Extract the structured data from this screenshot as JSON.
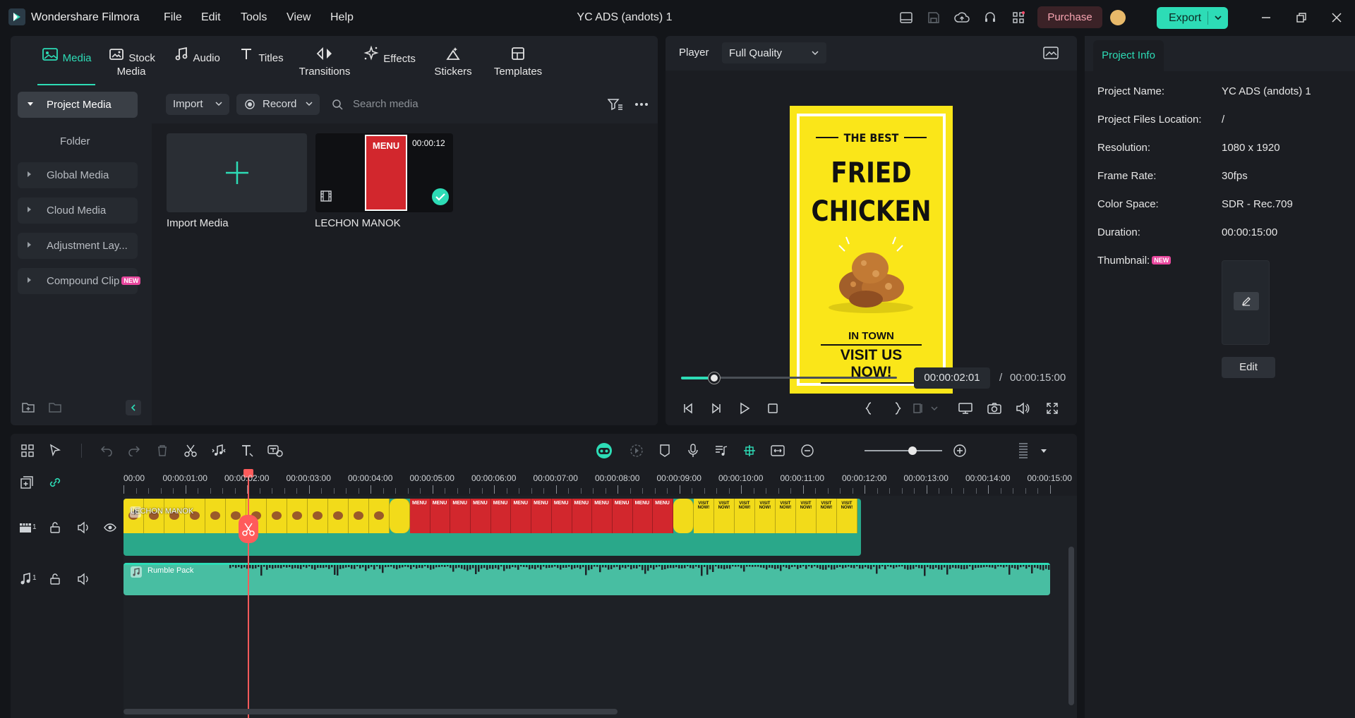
{
  "app": {
    "name": "Wondershare Filmora",
    "document_title": "YC ADS (andots) 1"
  },
  "menu": [
    "File",
    "Edit",
    "Tools",
    "View",
    "Help"
  ],
  "titlebar": {
    "purchase_label": "Purchase",
    "export_label": "Export"
  },
  "tabs": [
    {
      "label": "Media",
      "icon": "media-icon",
      "active": true
    },
    {
      "label": "Stock Media",
      "icon": "stock-media-icon"
    },
    {
      "label": "Audio",
      "icon": "music-note-icon"
    },
    {
      "label": "Titles",
      "icon": "text-t-icon"
    },
    {
      "label": "Transitions",
      "icon": "transitions-icon"
    },
    {
      "label": "Effects",
      "icon": "effects-sparkle-icon"
    },
    {
      "label": "Stickers",
      "icon": "stickers-icon"
    },
    {
      "label": "Templates",
      "icon": "templates-icon"
    }
  ],
  "sidebar": {
    "items": [
      {
        "label": "Project Media",
        "active": true
      },
      {
        "label": "Folder"
      },
      {
        "label": "Global Media"
      },
      {
        "label": "Cloud Media"
      },
      {
        "label": "Adjustment Lay..."
      },
      {
        "label": "Compound Clip",
        "badge": "NEW"
      }
    ]
  },
  "media_toolbar": {
    "import_label": "Import",
    "record_label": "Record",
    "search_placeholder": "Search media"
  },
  "media_items": [
    {
      "title": "Import Media"
    },
    {
      "title": "LECHON MANOK",
      "duration": "00:00:12",
      "thumb_text": "MENU"
    }
  ],
  "player": {
    "label": "Player",
    "quality": "Full Quality",
    "current_time": "00:00:02:01",
    "separator": "/",
    "total_time": "00:00:15:00",
    "progress": 0.135,
    "poster": {
      "line1": "THE BEST",
      "line2": "FRIED",
      "line3": "CHICKEN",
      "line4": "IN TOWN",
      "line5": "VISIT US NOW!",
      "bg_color": "#fae619"
    }
  },
  "project_info": {
    "tab_label": "Project Info",
    "rows": [
      {
        "label": "Project Name:",
        "value": "YC ADS (andots) 1"
      },
      {
        "label": "Project Files Location:",
        "value": "/"
      },
      {
        "label": "Resolution:",
        "value": "1080 x 1920"
      },
      {
        "label": "Frame Rate:",
        "value": "30fps"
      },
      {
        "label": "Color Space:",
        "value": "SDR - Rec.709"
      },
      {
        "label": "Duration:",
        "value": "00:00:15:00"
      }
    ],
    "thumbnail_label": "Thumbnail:",
    "thumbnail_badge": "NEW",
    "edit_label": "Edit"
  },
  "timeline": {
    "ruler": [
      "00:00",
      "00:00:01:00",
      "00:00:02:00",
      "00:00:03:00",
      "00:00:04:00",
      "00:00:05:00",
      "00:00:06:00",
      "00:00:07:00",
      "00:00:08:00",
      "00:00:09:00",
      "00:00:10:00",
      "00:00:11:00",
      "00:00:12:00",
      "00:00:13:00",
      "00:00:14:00",
      "00:00:15:00"
    ],
    "video_track": {
      "index": "1",
      "clip_label": "LECHON MANOK"
    },
    "audio_track": {
      "index": "1",
      "clip_label": "Rumble Pack"
    },
    "playhead_time": "00:00:02:01"
  },
  "colors": {
    "accent": "#2ddcb6",
    "playhead": "#ff5b5b",
    "audio_clip": "#48bea2",
    "video_clip": "#2aa88a"
  }
}
